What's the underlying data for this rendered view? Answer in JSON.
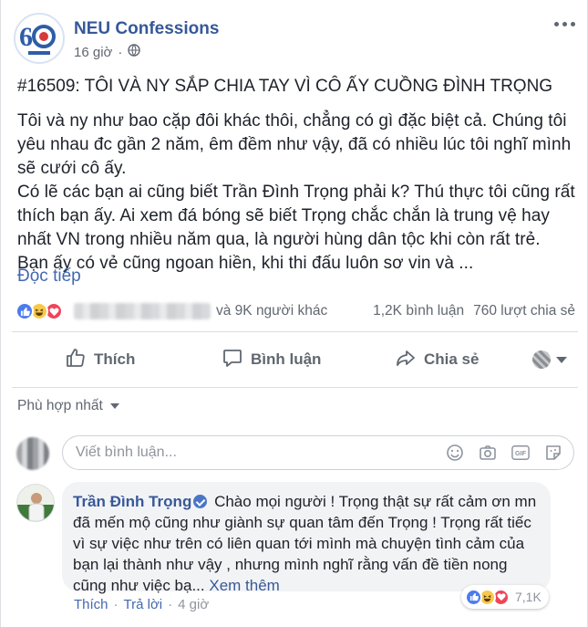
{
  "post": {
    "page_name": "NEU Confessions",
    "time": "16 giờ",
    "title": "#16509: TÔI VÀ NY SẮP CHIA TAY VÌ CÔ ẤY CUỒNG ĐÌNH TRỌNG",
    "paragraph_1": "Tôi và ny như bao cặp đôi khác thôi, chẳng có gì đặc biệt cả. Chúng tôi yêu nhau đc gần 2 năm, êm đềm như vậy, đã có nhiều lúc tôi nghĩ mình sẽ cưới cô ấy.",
    "paragraph_2": "Có lẽ các bạn ai cũng biết Trần Đình Trọng phải k? Thú thực tôi cũng rất thích bạn ấy. Ai xem đá bóng sẽ biết Trọng chắc chắn là trung vệ hay nhất VN trong nhiều năm qua, là người hùng dân tộc khi còn rất trẻ. Bạn ấy có vẻ cũng ngoan hiền, khi thi đấu luôn sơ vin và ...",
    "read_more": "Đọc tiếp"
  },
  "reactions": {
    "others": "và 9K người khác",
    "comments": "1,2K bình luận",
    "shares": "760 lượt chia sẻ"
  },
  "actions": {
    "like": "Thích",
    "comment": "Bình luận",
    "share": "Chia sẻ"
  },
  "comments_section": {
    "sort_label": "Phù hợp nhất",
    "input_placeholder": "Viết bình luận...",
    "input_icons": [
      "emoji-icon",
      "camera-icon",
      "gif-icon",
      "sticker-icon"
    ]
  },
  "top_comment": {
    "author": "Trần Đình Trọng",
    "text": "Chào mọi người ! Trọng thật sự rất cảm ơn mn đã mến mộ cũng như giành sự quan tâm đến Trọng ! Trọng rất tiếc vì sự việc như trên có liên quan tới mình mà chuyện tình cảm của bạn lại thành như vậy , nhưng mình nghĩ rằng vấn đề tiền nong cũng như việc bạ...",
    "see_more": "Xem thêm",
    "like": "Thích",
    "reply": "Trả lời",
    "separator": "·",
    "time": "4 giờ",
    "reaction_count": "7,1K"
  },
  "colors": {
    "link_blue": "#365899",
    "like_blue": "#4b7bec",
    "love_red": "#f0445a",
    "haha_yellow": "#f7c94b",
    "muted_gray": "#616770"
  }
}
